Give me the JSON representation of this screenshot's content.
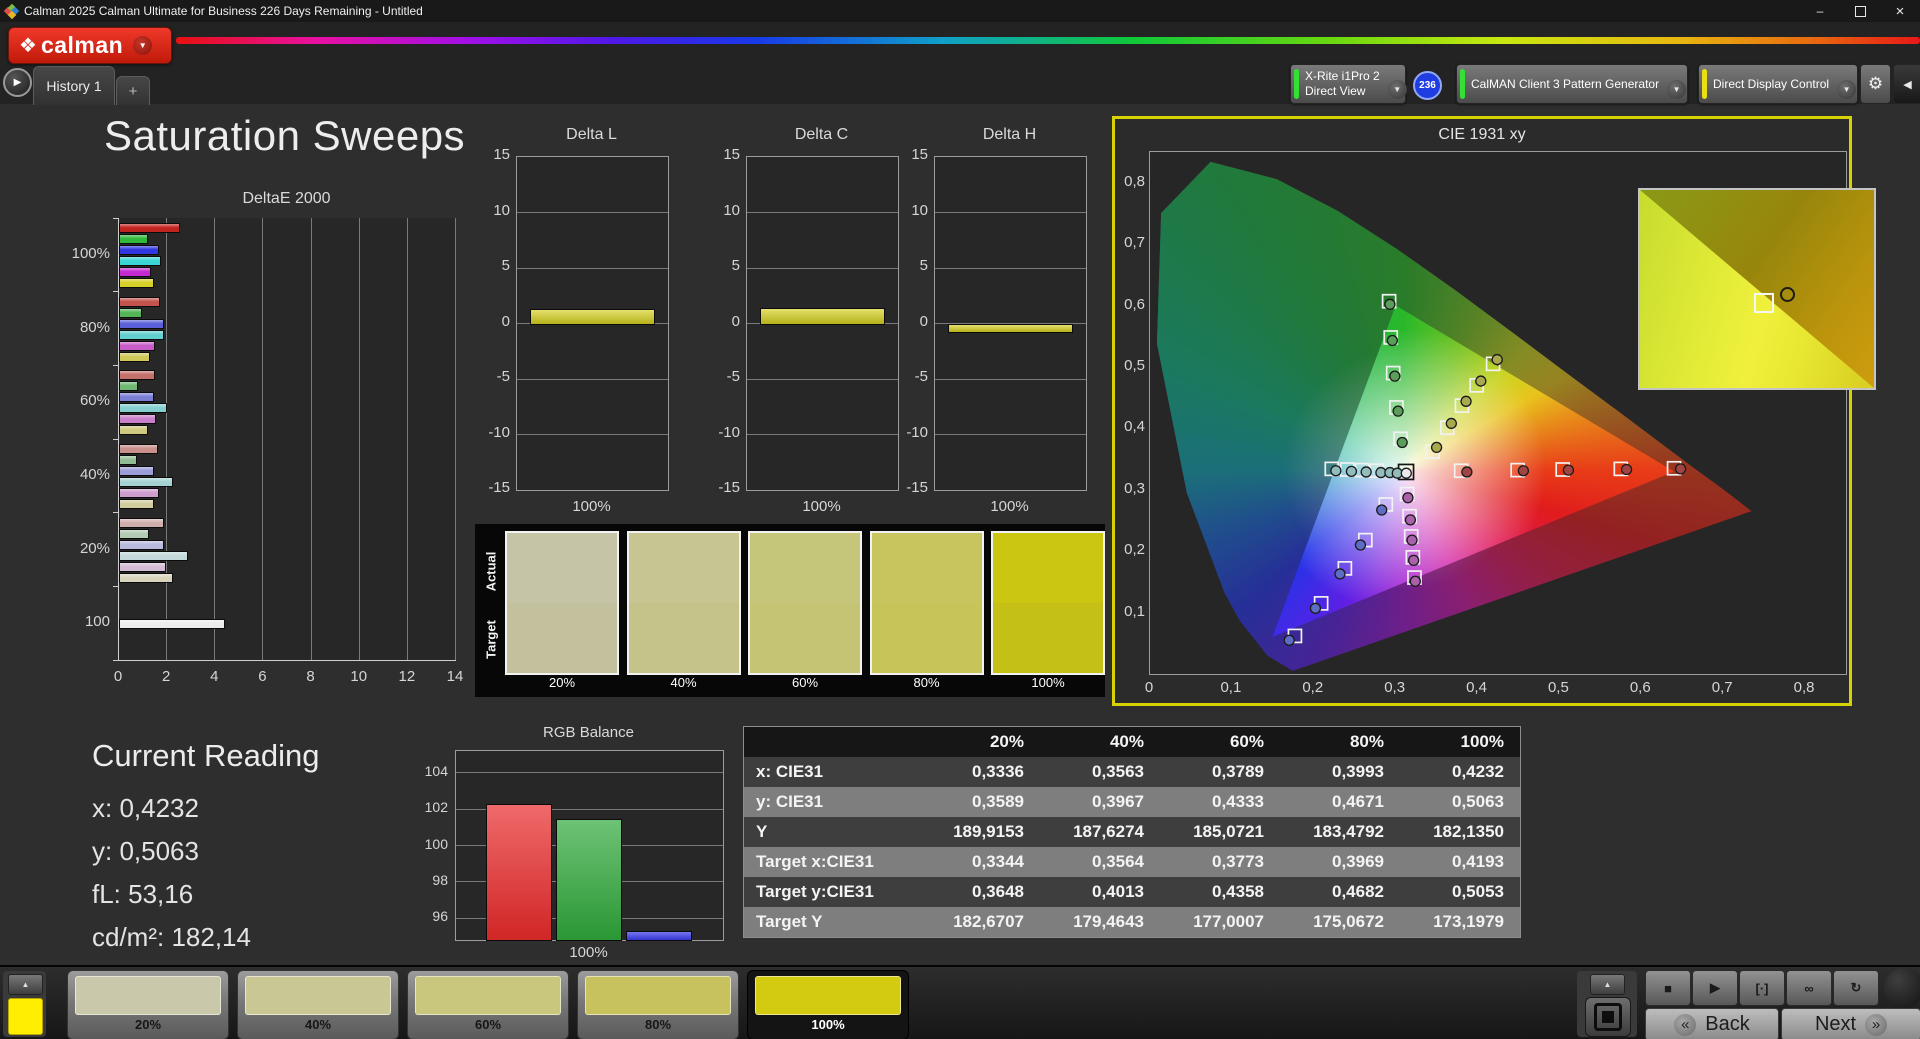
{
  "window": {
    "title": "Calman 2025 Calman Ultimate for Business 226 Days Remaining  - Untitled"
  },
  "icons": {
    "minimize": "–",
    "restore": "restore",
    "close": "×",
    "dropdown": "▼",
    "tab_play": "▶",
    "gear": "⚙",
    "collapse": "◀",
    "up_arrow": "▲",
    "brand_diamond": "❖",
    "stop": "■",
    "play": "▶",
    "measure": "[·]",
    "infinity": "∞",
    "refresh": "↻",
    "back_chevron": "«",
    "next_chevron": "»"
  },
  "brand": {
    "label": "calman"
  },
  "tabs": {
    "items": [
      "History 1"
    ],
    "add": "+"
  },
  "toolbar": {
    "meter": {
      "line1": "X-Rite i1Pro 2",
      "line2": "Direct View",
      "badge": "236",
      "accent": "#35e035"
    },
    "pattern_generator": {
      "label": "CalMAN Client 3 Pattern Generator",
      "accent": "#35e035"
    },
    "display_control": {
      "label": "Direct Display Control",
      "accent": "#e8e012"
    }
  },
  "page_title": "Saturation Sweeps",
  "current_reading": {
    "title": "Current Reading",
    "items": [
      {
        "label": "x",
        "value": "0,4232"
      },
      {
        "label": "y",
        "value": "0,5063"
      },
      {
        "label": "fL",
        "value": "53,16"
      },
      {
        "label": "cd/m²",
        "value": "182,14"
      }
    ]
  },
  "swatch_panel": {
    "row_labels": [
      "Actual",
      "Target"
    ],
    "columns": [
      {
        "label": "20%",
        "actual": "#c6c4a6",
        "target": "#c3c19d"
      },
      {
        "label": "40%",
        "actual": "#c7c591",
        "target": "#c5c38a"
      },
      {
        "label": "60%",
        "actual": "#c6c67b",
        "target": "#c4c474"
      },
      {
        "label": "80%",
        "actual": "#c8c45e",
        "target": "#c7c55a"
      },
      {
        "label": "100%",
        "actual": "#cac612",
        "target": "#c5c015"
      }
    ]
  },
  "table": {
    "headers": [
      "",
      "20%",
      "40%",
      "60%",
      "80%",
      "100%"
    ],
    "rows": [
      {
        "label": "x: CIE31",
        "values": [
          "0,3336",
          "0,3563",
          "0,3789",
          "0,3993",
          "0,4232"
        ]
      },
      {
        "label": "y: CIE31",
        "values": [
          "0,3589",
          "0,3967",
          "0,4333",
          "0,4671",
          "0,5063"
        ]
      },
      {
        "label": "Y",
        "values": [
          "189,9153",
          "187,6274",
          "185,0721",
          "183,4792",
          "182,1350"
        ]
      },
      {
        "label": "Target x:CIE31",
        "values": [
          "0,3344",
          "0,3564",
          "0,3773",
          "0,3969",
          "0,4193"
        ]
      },
      {
        "label": "Target y:CIE31",
        "values": [
          "0,3648",
          "0,4013",
          "0,4358",
          "0,4682",
          "0,5053"
        ]
      },
      {
        "label": "Target Y",
        "values": [
          "182,6707",
          "179,4643",
          "177,0007",
          "175,0672",
          "173,1979"
        ]
      }
    ],
    "row_colors": [
      "#3e3e3e",
      "#7e7e7e",
      "#3e3e3e",
      "#7e7e7e",
      "#3e3e3e",
      "#7e7e7e"
    ],
    "header_color": "#161616"
  },
  "bottom_bar": {
    "patterns": [
      {
        "label": "20%",
        "color": "#c9c8ab",
        "selected": false
      },
      {
        "label": "40%",
        "color": "#c9c794",
        "selected": false
      },
      {
        "label": "60%",
        "color": "#c8c77d",
        "selected": false
      },
      {
        "label": "80%",
        "color": "#c8c25e",
        "selected": false
      },
      {
        "label": "100%",
        "color": "#d2cb10",
        "selected": true
      }
    ],
    "transport": [
      "stop",
      "play",
      "measure",
      "infinity",
      "refresh"
    ],
    "back": "Back",
    "next": "Next"
  },
  "chart_data": [
    {
      "id": "deltae",
      "type": "bar",
      "orientation": "horizontal",
      "title": "DeltaE 2000",
      "xlim": [
        0,
        14
      ],
      "xticks": [
        0,
        2,
        4,
        6,
        8,
        10,
        12,
        14
      ],
      "bar_order": [
        "red",
        "green",
        "blue",
        "cyan",
        "magenta",
        "yellow"
      ],
      "groups": [
        {
          "label": "100%",
          "values": [
            2.55,
            1.2,
            1.65,
            1.75,
            1.35,
            1.45
          ],
          "colors": [
            "#c0241f",
            "#2fb83a",
            "#3036e0",
            "#3ad4d4",
            "#c42ad0",
            "#d6d028"
          ]
        },
        {
          "label": "80%",
          "values": [
            1.7,
            0.95,
            1.85,
            1.85,
            1.5,
            1.3
          ],
          "colors": [
            "#c4534d",
            "#53b557",
            "#5b60d8",
            "#64cfcf",
            "#c85cc9",
            "#cfc95a"
          ]
        },
        {
          "label": "60%",
          "values": [
            1.5,
            0.8,
            1.45,
            2.0,
            1.55,
            1.2
          ],
          "colors": [
            "#c4706b",
            "#6fb873",
            "#7b7fd6",
            "#85cfcf",
            "#c97fc9",
            "#cfc97f"
          ]
        },
        {
          "label": "40%",
          "values": [
            1.6,
            0.75,
            1.45,
            2.25,
            1.65,
            1.45
          ],
          "colors": [
            "#c9908c",
            "#92bd94",
            "#9a9dd8",
            "#a5d2d2",
            "#cd9ecd",
            "#d2cd9e"
          ]
        },
        {
          "label": "20%",
          "values": [
            1.85,
            1.25,
            1.85,
            2.85,
            1.95,
            2.25
          ],
          "colors": [
            "#d0aeac",
            "#b3cbb4",
            "#b8bade",
            "#c3d8d8",
            "#d5bcd5",
            "#d8d5bc"
          ]
        },
        {
          "label": "100",
          "values": [
            4.4
          ],
          "colors": [
            "#ececec"
          ]
        }
      ]
    },
    {
      "id": "deltaL",
      "type": "bar",
      "title": "Delta L",
      "categories": [
        "100%"
      ],
      "values": [
        1.3
      ],
      "ylim": [
        -15,
        15
      ],
      "yticks": [
        15,
        10,
        5,
        0,
        -5,
        -10,
        -15
      ],
      "bar_color": "#d6d01e"
    },
    {
      "id": "deltaC",
      "type": "bar",
      "title": "Delta C",
      "categories": [
        "100%"
      ],
      "values": [
        1.4
      ],
      "ylim": [
        -15,
        15
      ],
      "yticks": [
        15,
        10,
        5,
        0,
        -5,
        -10,
        -15
      ],
      "bar_color": "#d6d01e"
    },
    {
      "id": "deltaH",
      "type": "bar",
      "title": "Delta H",
      "categories": [
        "100%"
      ],
      "values": [
        -0.7
      ],
      "ylim": [
        -15,
        15
      ],
      "yticks": [
        15,
        10,
        5,
        0,
        -5,
        -10,
        -15
      ],
      "bar_color": "#d6d01e"
    },
    {
      "id": "rgb",
      "type": "bar",
      "title": "RGB Balance",
      "categories": [
        "100%"
      ],
      "ylim": [
        94.8,
        105.2
      ],
      "yticks": [
        104,
        102,
        100,
        98,
        96
      ],
      "series": [
        {
          "name": "Red",
          "value": 102.3,
          "color": "#e82a2a"
        },
        {
          "name": "Green",
          "value": 101.45,
          "color": "#2fa83a"
        },
        {
          "name": "Blue",
          "value": 95.3,
          "color": "#3a3ae8"
        }
      ]
    },
    {
      "id": "cie",
      "type": "scatter",
      "title": "CIE 1931 xy",
      "xlim": [
        0,
        0.85
      ],
      "ylim": [
        0,
        0.85
      ],
      "xticks": [
        0,
        0.1,
        0.2,
        0.3,
        0.4,
        0.5,
        0.6,
        0.7,
        0.8
      ],
      "xtick_labels": [
        "0",
        "0,1",
        "0,2",
        "0,3",
        "0,4",
        "0,5",
        "0,6",
        "0,7",
        "0,8"
      ],
      "yticks": [
        0,
        0.1,
        0.2,
        0.3,
        0.4,
        0.5,
        0.6,
        0.7,
        0.8
      ],
      "ytick_labels": [
        "0",
        "0,1",
        "0,2",
        "0,3",
        "0,4",
        "0,5",
        "0,6",
        "0,7",
        "0,8"
      ],
      "white_point": [
        0.3127,
        0.329
      ],
      "sweeps": [
        {
          "name": "red",
          "color": "#a24444",
          "pairs": [
            [
              [
                0.38,
                0.331
              ],
              [
                0.387,
                0.329
              ]
            ],
            [
              [
                0.449,
                0.332
              ],
              [
                0.456,
                0.331
              ]
            ],
            [
              [
                0.504,
                0.333
              ],
              [
                0.511,
                0.332
              ]
            ],
            [
              [
                0.575,
                0.334
              ],
              [
                0.582,
                0.333
              ]
            ],
            [
              [
                0.64,
                0.335
              ],
              [
                0.648,
                0.334
              ]
            ]
          ]
        },
        {
          "name": "green",
          "color": "#5a9e5a",
          "pairs": [
            [
              [
                0.306,
                0.383
              ],
              [
                0.308,
                0.377
              ]
            ],
            [
              [
                0.301,
                0.434
              ],
              [
                0.303,
                0.428
              ]
            ],
            [
              [
                0.297,
                0.49
              ],
              [
                0.299,
                0.485
              ]
            ],
            [
              [
                0.294,
                0.548
              ],
              [
                0.296,
                0.543
              ]
            ],
            [
              [
                0.292,
                0.607
              ],
              [
                0.293,
                0.602
              ]
            ]
          ]
        },
        {
          "name": "blue",
          "color": "#5d6cc4",
          "pairs": [
            [
              [
                0.288,
                0.276
              ],
              [
                0.283,
                0.267
              ]
            ],
            [
              [
                0.263,
                0.218
              ],
              [
                0.257,
                0.21
              ]
            ],
            [
              [
                0.238,
                0.172
              ],
              [
                0.232,
                0.163
              ]
            ],
            [
              [
                0.209,
                0.115
              ],
              [
                0.202,
                0.107
              ]
            ],
            [
              [
                0.177,
                0.062
              ],
              [
                0.17,
                0.055
              ]
            ]
          ]
        },
        {
          "name": "cyan",
          "color": "#93bdbd",
          "pairs": [
            [
              [
                0.222,
                0.334
              ],
              [
                0.227,
                0.331
              ]
            ],
            [
              [
                0.241,
                0.333
              ],
              [
                0.246,
                0.33
              ]
            ],
            [
              [
                0.259,
                0.332
              ],
              [
                0.264,
                0.329
              ]
            ],
            [
              [
                0.277,
                0.331
              ],
              [
                0.282,
                0.328
              ]
            ]
          ],
          "extra_circles": [
            [
              0.293,
              0.328
            ],
            [
              0.302,
              0.327
            ]
          ]
        },
        {
          "name": "magenta",
          "color": "#a961a9",
          "pairs": [
            [
              [
                0.314,
                0.293
              ],
              [
                0.315,
                0.287
              ]
            ],
            [
              [
                0.317,
                0.257
              ],
              [
                0.318,
                0.251
              ]
            ],
            [
              [
                0.319,
                0.224
              ],
              [
                0.32,
                0.218
              ]
            ],
            [
              [
                0.321,
                0.19
              ],
              [
                0.322,
                0.185
              ]
            ],
            [
              [
                0.323,
                0.157
              ],
              [
                0.324,
                0.151
              ]
            ]
          ]
        },
        {
          "name": "yellow",
          "color": "#a9a94e",
          "pairs": [
            [
              [
                0.345,
                0.362
              ],
              [
                0.35,
                0.369
              ]
            ],
            [
              [
                0.363,
                0.401
              ],
              [
                0.368,
                0.408
              ]
            ],
            [
              [
                0.381,
                0.437
              ],
              [
                0.386,
                0.444
              ]
            ],
            [
              [
                0.399,
                0.47
              ],
              [
                0.404,
                0.477
              ]
            ],
            [
              [
                0.419,
                0.505
              ],
              [
                0.424,
                0.512
              ]
            ]
          ]
        },
        {
          "name": "white",
          "color": "#e9e9e9",
          "white_point": true,
          "pairs": [
            [
              [
                0.3127,
                0.329
              ],
              [
                0.313,
                0.327
              ]
            ]
          ]
        }
      ],
      "inset": {
        "square": [
          0.52,
          0.56
        ],
        "circle": [
          0.625,
          0.52
        ]
      }
    }
  ]
}
